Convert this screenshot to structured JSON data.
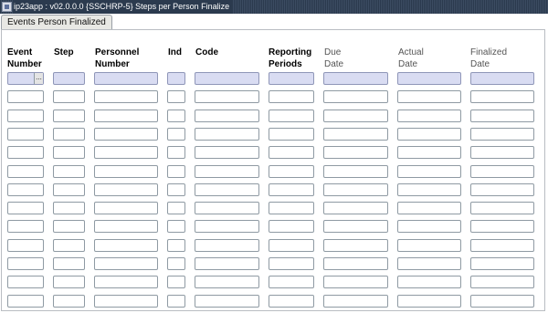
{
  "window": {
    "title": "ip23app : v02.0.0.0 {SSCHRP-5} Steps per Person Finalize"
  },
  "tabs": [
    {
      "label": "Events Person Finalized",
      "active": true
    }
  ],
  "columns": [
    {
      "key": "event_number",
      "label": "Event\nNumber",
      "bold": true
    },
    {
      "key": "step",
      "label": "Step",
      "bold": true
    },
    {
      "key": "personnel_number",
      "label": "Personnel\nNumber",
      "bold": true
    },
    {
      "key": "ind",
      "label": "Ind",
      "bold": true
    },
    {
      "key": "code",
      "label": "Code",
      "bold": true
    },
    {
      "key": "reporting_periods",
      "label": "Reporting\nPeriods",
      "bold": true
    },
    {
      "key": "due_date",
      "label": "Due\nDate",
      "bold": false
    },
    {
      "key": "actual_date",
      "label": "Actual\nDate",
      "bold": false
    },
    {
      "key": "finalized_date",
      "label": "Finalized\nDate",
      "bold": false
    }
  ],
  "rows": [
    [
      "",
      "",
      "",
      "",
      "",
      "",
      "",
      "",
      ""
    ],
    [
      "",
      "",
      "",
      "",
      "",
      "",
      "",
      "",
      ""
    ],
    [
      "",
      "",
      "",
      "",
      "",
      "",
      "",
      "",
      ""
    ],
    [
      "",
      "",
      "",
      "",
      "",
      "",
      "",
      "",
      ""
    ],
    [
      "",
      "",
      "",
      "",
      "",
      "",
      "",
      "",
      ""
    ],
    [
      "",
      "",
      "",
      "",
      "",
      "",
      "",
      "",
      ""
    ],
    [
      "",
      "",
      "",
      "",
      "",
      "",
      "",
      "",
      ""
    ],
    [
      "",
      "",
      "",
      "",
      "",
      "",
      "",
      "",
      ""
    ],
    [
      "",
      "",
      "",
      "",
      "",
      "",
      "",
      "",
      ""
    ],
    [
      "",
      "",
      "",
      "",
      "",
      "",
      "",
      "",
      ""
    ],
    [
      "",
      "",
      "",
      "",
      "",
      "",
      "",
      "",
      ""
    ],
    [
      "",
      "",
      "",
      "",
      "",
      "",
      "",
      "",
      ""
    ],
    [
      "",
      "",
      "",
      "",
      "",
      "",
      "",
      "",
      ""
    ]
  ],
  "lov_button_label": "...",
  "colors": {
    "titlebar": "#2b3a4e",
    "current_row_field": "#d9dcf2",
    "field_border": "#8f9aa3"
  }
}
